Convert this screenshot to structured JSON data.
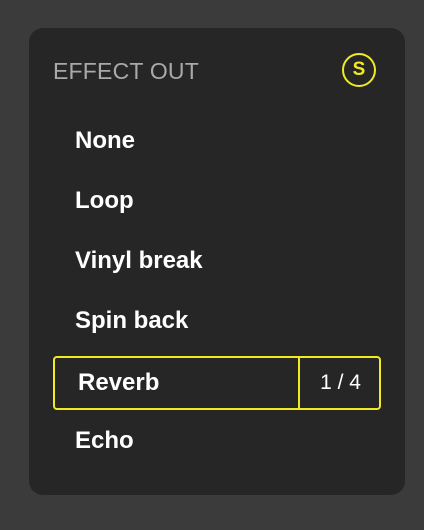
{
  "panel": {
    "title": "EFFECT OUT",
    "badge": "S",
    "accent_color": "#f2ea21"
  },
  "menu": {
    "items": [
      {
        "label": "None"
      },
      {
        "label": "Loop"
      },
      {
        "label": "Vinyl break"
      },
      {
        "label": "Spin back"
      },
      {
        "label": "Reverb",
        "selected": true,
        "counter": "1 / 4"
      },
      {
        "label": "Echo"
      }
    ]
  }
}
